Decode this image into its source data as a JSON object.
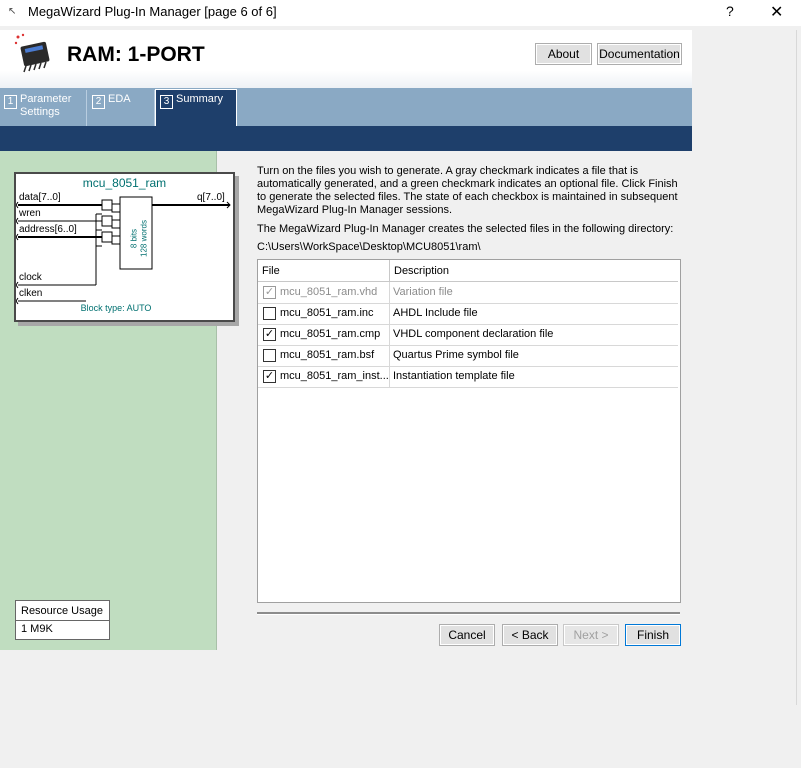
{
  "window": {
    "title": "MegaWizard Plug-In Manager [page 6 of 6]",
    "help": "?",
    "close": "✕"
  },
  "header": {
    "title": "RAM: 1-PORT",
    "about": "About",
    "documentation": "Documentation"
  },
  "tabs": [
    {
      "num": "1",
      "label": "Parameter Settings"
    },
    {
      "num": "2",
      "label": "EDA"
    },
    {
      "num": "3",
      "label": "Summary"
    }
  ],
  "symbol": {
    "name": "mcu_8051_ram",
    "pins_in": [
      "data[7..0]",
      "wren",
      "address[6..0]",
      "clock",
      "clken"
    ],
    "pin_out": "q[7..0]",
    "bits": "8 bits",
    "words": "128 words",
    "block_type": "Block type: AUTO"
  },
  "resource": {
    "label": "Resource Usage",
    "value": "1 M9K"
  },
  "instructions": "Turn on the files you wish to generate. A gray checkmark indicates a file that is automatically generated, and a green checkmark indicates an optional file. Click Finish to generate the selected files. The state of each checkbox is maintained in subsequent MegaWizard Plug-In Manager sessions.",
  "directory_label": "The MegaWizard Plug-In Manager creates the selected files in the following directory:",
  "directory_path": "C:\\Users\\WorkSpace\\Desktop\\MCU8051\\ram\\",
  "table": {
    "headers": [
      "File",
      "Description"
    ],
    "rows": [
      {
        "file": "mcu_8051_ram.vhd",
        "desc": "Variation file",
        "mark": "✓"
      },
      {
        "file": "mcu_8051_ram.inc",
        "desc": "AHDL Include file",
        "mark": ""
      },
      {
        "file": "mcu_8051_ram.cmp",
        "desc": "VHDL component declaration file",
        "mark": "✓"
      },
      {
        "file": "mcu_8051_ram.bsf",
        "desc": "Quartus Prime symbol file",
        "mark": ""
      },
      {
        "file": "mcu_8051_ram_inst...",
        "desc": "Instantiation template file",
        "mark": "✓"
      }
    ]
  },
  "buttons": {
    "cancel": "Cancel",
    "back": "< Back",
    "next": "Next >",
    "finish": "Finish"
  }
}
